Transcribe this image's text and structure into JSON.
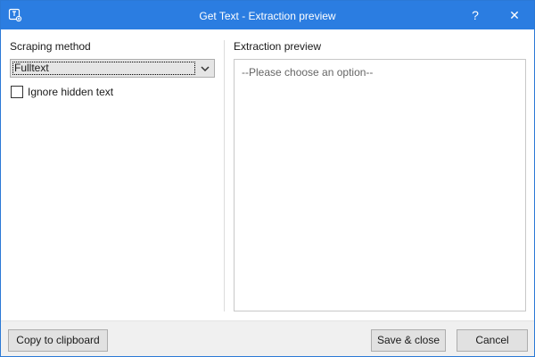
{
  "window": {
    "title": "Get Text - Extraction preview",
    "help_label": "?",
    "close_label": "✕",
    "accent_color": "#2b7de1"
  },
  "left_panel": {
    "scraping_method_label": "Scraping method",
    "scraping_method_value": "Fulltext",
    "ignore_hidden_label": "Ignore hidden text",
    "ignore_hidden_checked": false
  },
  "right_panel": {
    "preview_label": "Extraction preview",
    "preview_placeholder": "--Please choose an option--"
  },
  "footer": {
    "copy_label": "Copy to clipboard",
    "save_label": "Save & close",
    "cancel_label": "Cancel"
  },
  "icons": {
    "app": "get-text-icon",
    "dropdown": "chevron-down-icon"
  }
}
